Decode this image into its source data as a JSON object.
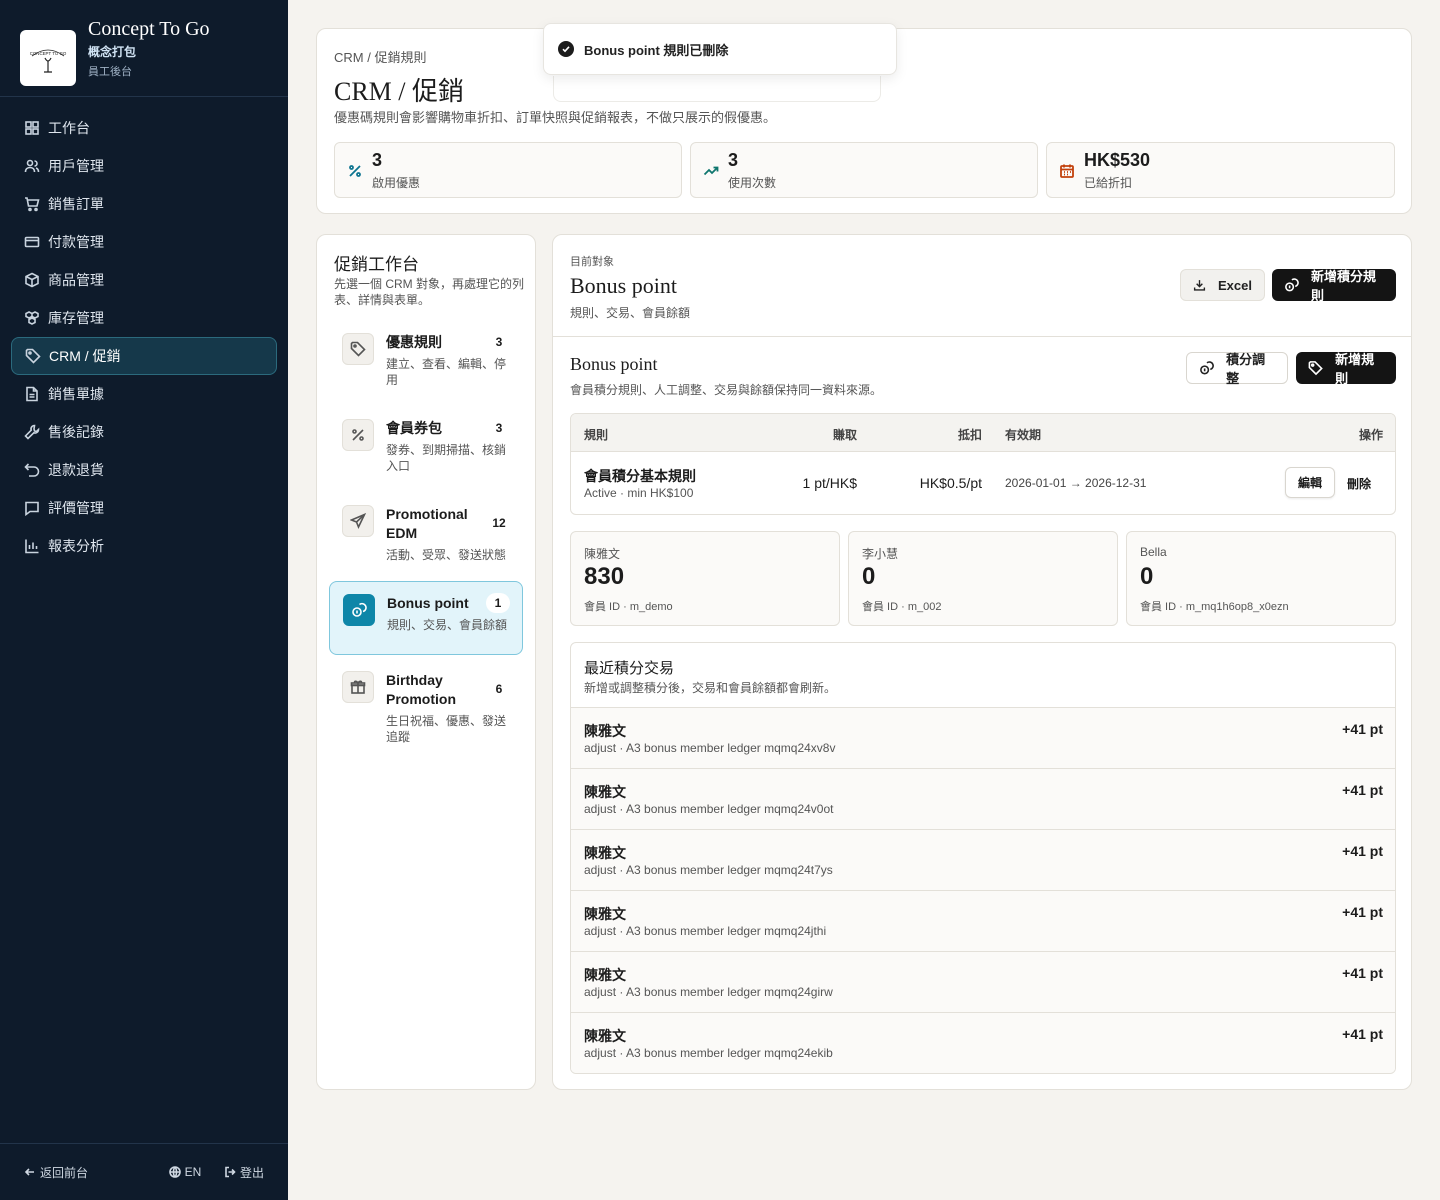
{
  "brand": {
    "name": "Concept To Go",
    "sub": "概念打包",
    "sub2": "員工後台",
    "logo_text": "CONCEPT TO GO"
  },
  "nav": [
    {
      "label": "工作台",
      "icon": "dashboard-icon"
    },
    {
      "label": "用戶管理",
      "icon": "users-icon"
    },
    {
      "label": "銷售訂單",
      "icon": "cart-icon"
    },
    {
      "label": "付款管理",
      "icon": "card-icon"
    },
    {
      "label": "商品管理",
      "icon": "box-icon"
    },
    {
      "label": "庫存管理",
      "icon": "boxes-icon"
    },
    {
      "label": "CRM / 促銷",
      "icon": "tag-icon",
      "active": true
    },
    {
      "label": "銷售單據",
      "icon": "document-icon"
    },
    {
      "label": "售後記錄",
      "icon": "wrench-icon"
    },
    {
      "label": "退款退貨",
      "icon": "undo-icon"
    },
    {
      "label": "評價管理",
      "icon": "message-icon"
    },
    {
      "label": "報表分析",
      "icon": "bar-chart-icon"
    }
  ],
  "footer": {
    "back": "返回前台",
    "lang": "EN",
    "logout": "登出"
  },
  "toast": {
    "text": "Bonus point 規則已刪除"
  },
  "header": {
    "breadcrumb": "CRM / 促銷規則",
    "title": "CRM / 促銷",
    "desc": "優惠碼規則會影響購物車折扣、訂單快照與促銷報表，不做只展示的假優惠。",
    "stats": [
      {
        "value": "3",
        "label": "啟用優惠",
        "icon": "percent-icon",
        "color": "#0e7490"
      },
      {
        "value": "3",
        "label": "使用次數",
        "icon": "trending-icon",
        "color": "#0f766e"
      },
      {
        "value": "HK$530",
        "label": "已給折扣",
        "icon": "calendar-icon",
        "color": "#c2410c"
      }
    ]
  },
  "tools": {
    "title": "促銷工作台",
    "desc": "先選一個 CRM 對象，再處理它的列表、詳情與表單。",
    "items": [
      {
        "name": "優惠規則",
        "desc": "建立、查看、編輯、停用",
        "count": "3",
        "icon": "tag-icon"
      },
      {
        "name": "會員券包",
        "desc": "發券、到期掃描、核銷入口",
        "count": "3",
        "icon": "percent-icon"
      },
      {
        "name": "Promotional EDM",
        "desc": "活動、受眾、發送狀態",
        "count": "12",
        "icon": "send-icon"
      },
      {
        "name": "Bonus point",
        "desc": "規則、交易、會員餘額",
        "count": "1",
        "icon": "coins-icon",
        "active": true
      },
      {
        "name": "Birthday Promotion",
        "desc": "生日祝福、優惠、發送追蹤",
        "count": "6",
        "icon": "gift-icon"
      }
    ]
  },
  "main": {
    "label": "目前對象",
    "title": "Bonus point",
    "sub": "規則、交易、會員餘額",
    "excel": "Excel",
    "add_points_rule": "新增積分規則",
    "section_title": "Bonus point",
    "section_desc": "會員積分規則、人工調整、交易與餘額保持同一資料來源。",
    "adjust": "積分調整",
    "add_rule": "新增規則",
    "table": {
      "headers": {
        "rule": "規則",
        "earn": "賺取",
        "redeem": "抵扣",
        "validity": "有效期",
        "ops": "操作"
      },
      "rows": [
        {
          "name": "會員積分基本規則",
          "meta": "Active · min HK$100",
          "earn": "1 pt/HK$",
          "redeem": "HK$0.5/pt",
          "validity": "2026-01-01 → 2026-12-31",
          "edit": "編輯",
          "delete": "刪除"
        }
      ]
    },
    "members": [
      {
        "name": "陳雅文",
        "balance": "830",
        "id": "會員 ID · m_demo"
      },
      {
        "name": "李小慧",
        "balance": "0",
        "id": "會員 ID · m_002"
      },
      {
        "name": "Bella",
        "balance": "0",
        "id": "會員 ID · m_mq1h6op8_x0ezn"
      }
    ],
    "tx": {
      "title": "最近積分交易",
      "desc": "新增或調整積分後，交易和會員餘額都會刷新。",
      "rows": [
        {
          "name": "陳雅文",
          "detail": "adjust · A3 bonus member ledger mqmq24xv8v",
          "amount": "+41 pt"
        },
        {
          "name": "陳雅文",
          "detail": "adjust · A3 bonus member ledger mqmq24v0ot",
          "amount": "+41 pt"
        },
        {
          "name": "陳雅文",
          "detail": "adjust · A3 bonus member ledger mqmq24t7ys",
          "amount": "+41 pt"
        },
        {
          "name": "陳雅文",
          "detail": "adjust · A3 bonus member ledger mqmq24jthi",
          "amount": "+41 pt"
        },
        {
          "name": "陳雅文",
          "detail": "adjust · A3 bonus member ledger mqmq24girw",
          "amount": "+41 pt"
        },
        {
          "name": "陳雅文",
          "detail": "adjust · A3 bonus member ledger mqmq24ekib",
          "amount": "+41 pt"
        }
      ]
    }
  }
}
